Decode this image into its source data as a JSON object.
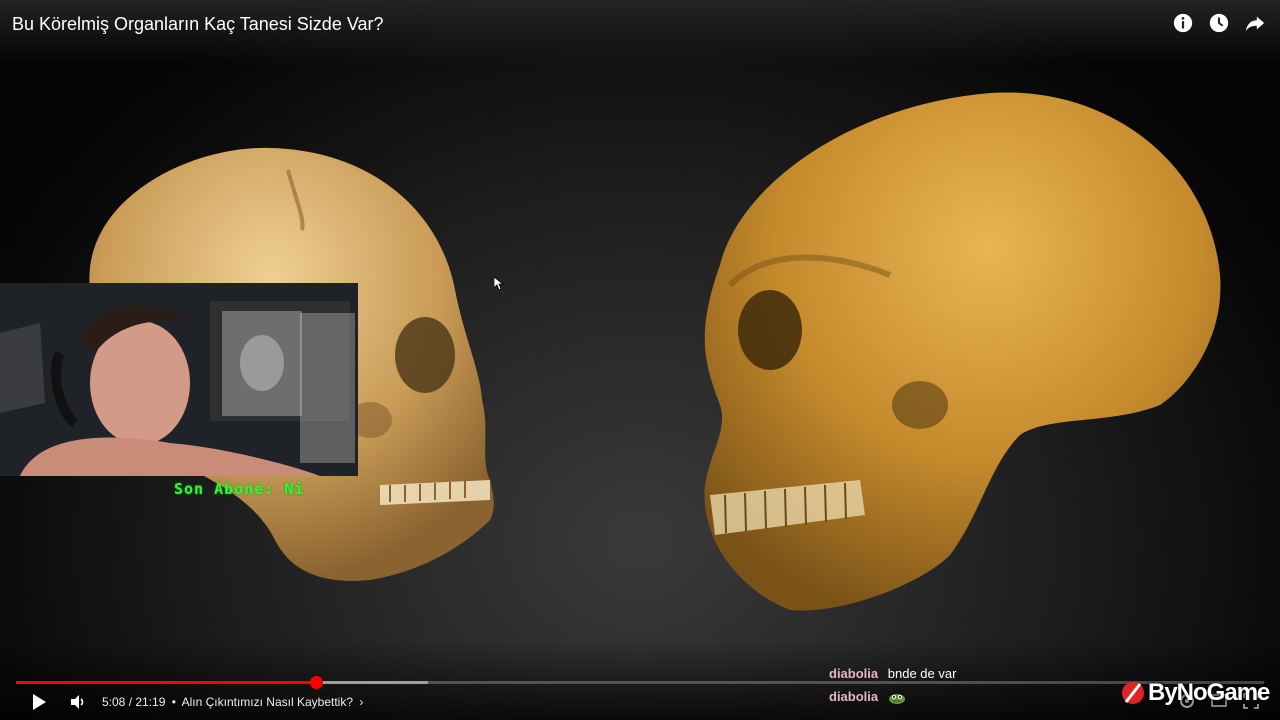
{
  "video": {
    "title": "Bu Körelmiş Organların Kaç Tanesi Sizde Var?",
    "top_icons": [
      "info-icon",
      "watch-later-icon",
      "share-icon"
    ]
  },
  "overlay": {
    "subscriber_text": "Son Abone: Ni"
  },
  "controls": {
    "time": "5:08 / 21:19",
    "separator": "•",
    "chapter": "Alın Çıkıntımızı Nasıl Kaybettik?",
    "chapter_arrow": "›",
    "progress_played": 0.24,
    "progress_loaded": 0.33,
    "accent_color": "#ff0000"
  },
  "chat": [
    {
      "user": "diabolia",
      "message": "bnde de var"
    },
    {
      "user": "diabolia",
      "message": "",
      "emote": "frog-emote"
    }
  ],
  "branding": {
    "logo_text": "ByNoGame"
  }
}
